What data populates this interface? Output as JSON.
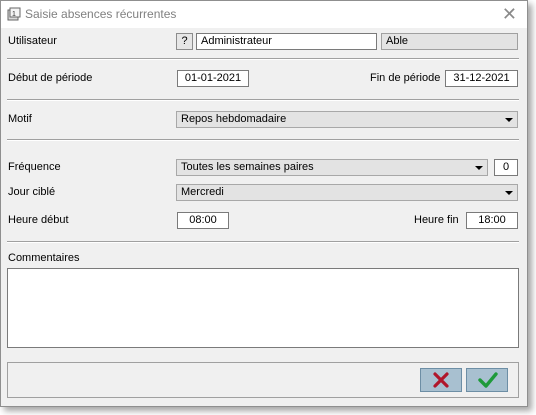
{
  "window": {
    "title": "Saisie absences récurrentes",
    "close_icon": "close-icon"
  },
  "user": {
    "label": "Utilisateur",
    "lookup_label": "?",
    "value": "Administrateur",
    "secondary": "Able"
  },
  "period": {
    "start_label": "Début de période",
    "start_value": "01-01-2021",
    "end_label": "Fin de période",
    "end_value": "31-12-2021"
  },
  "reason": {
    "label": "Motif",
    "value": "Repos hebdomadaire"
  },
  "frequency": {
    "label": "Fréquence",
    "value": "Toutes les semaines paires",
    "count": "0"
  },
  "target_day": {
    "label": "Jour ciblé",
    "value": "Mercredi"
  },
  "time": {
    "start_label": "Heure début",
    "start_value": "08:00",
    "end_label": "Heure fin",
    "end_value": "18:00"
  },
  "comments": {
    "label": "Commentaires",
    "value": ""
  },
  "buttons": {
    "cancel_icon": "x-mark-icon",
    "cancel_color": "#b0162b",
    "ok_icon": "check-icon",
    "ok_color": "#1e9a3a"
  }
}
